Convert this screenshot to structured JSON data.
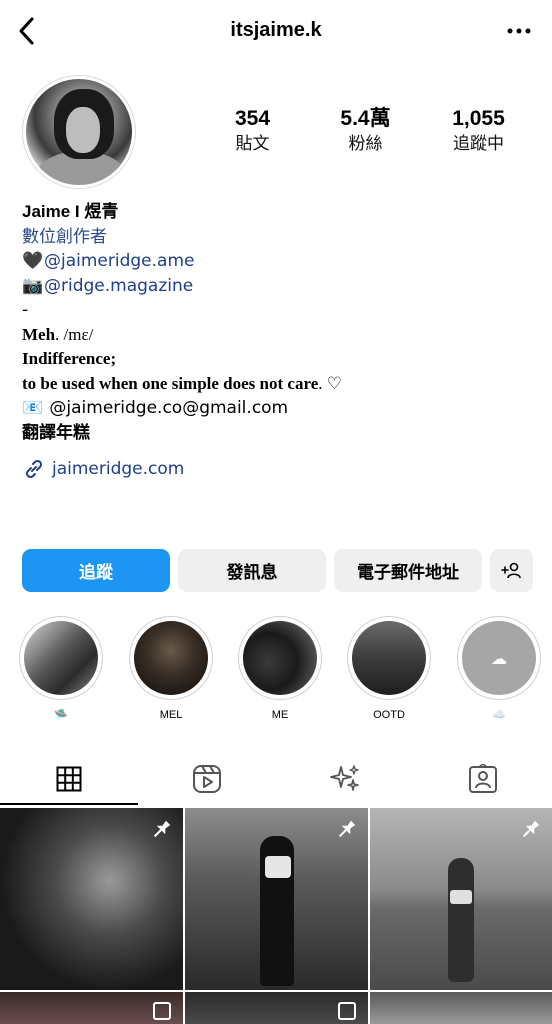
{
  "header": {
    "username": "itsjaime.k",
    "back_icon": "chevron-left-icon",
    "more_icon": "more-horizontal-icon"
  },
  "stats": {
    "posts": {
      "value": "354",
      "label": "貼文"
    },
    "followers": {
      "value": "5.4萬",
      "label": "粉絲"
    },
    "following": {
      "value": "1,055",
      "label": "追蹤中"
    }
  },
  "bio": {
    "name": "Jaime I 煜青",
    "category": "數位創作者",
    "line1_prefix": "🖤",
    "line1_mention": "@jaimeridge.ame",
    "line2_prefix": "📷",
    "line2_mention": "@ridge.magazine",
    "line3": "-",
    "line4_bold": "Meh",
    "line4_rest": ". /mɛ/",
    "line5": "Indifference;",
    "line6_bold": "to be used when one simple does not care",
    "line6_rest": ". ♡",
    "line7_prefix": "📧",
    "line7_text": "@jaimeridge.co@gmail.com",
    "line8": "翻譯年糕",
    "link": "jaimeridge.com"
  },
  "buttons": {
    "follow": "追蹤",
    "message": "發訊息",
    "email": "電子郵件地址"
  },
  "highlights": [
    {
      "label": "🛸"
    },
    {
      "label": "MEL"
    },
    {
      "label": "ME"
    },
    {
      "label": "OOTD"
    },
    {
      "label": "☁️"
    }
  ],
  "colors": {
    "accent": "#1d95f2",
    "link": "#1f3f8a",
    "button_secondary": "#efefef"
  }
}
